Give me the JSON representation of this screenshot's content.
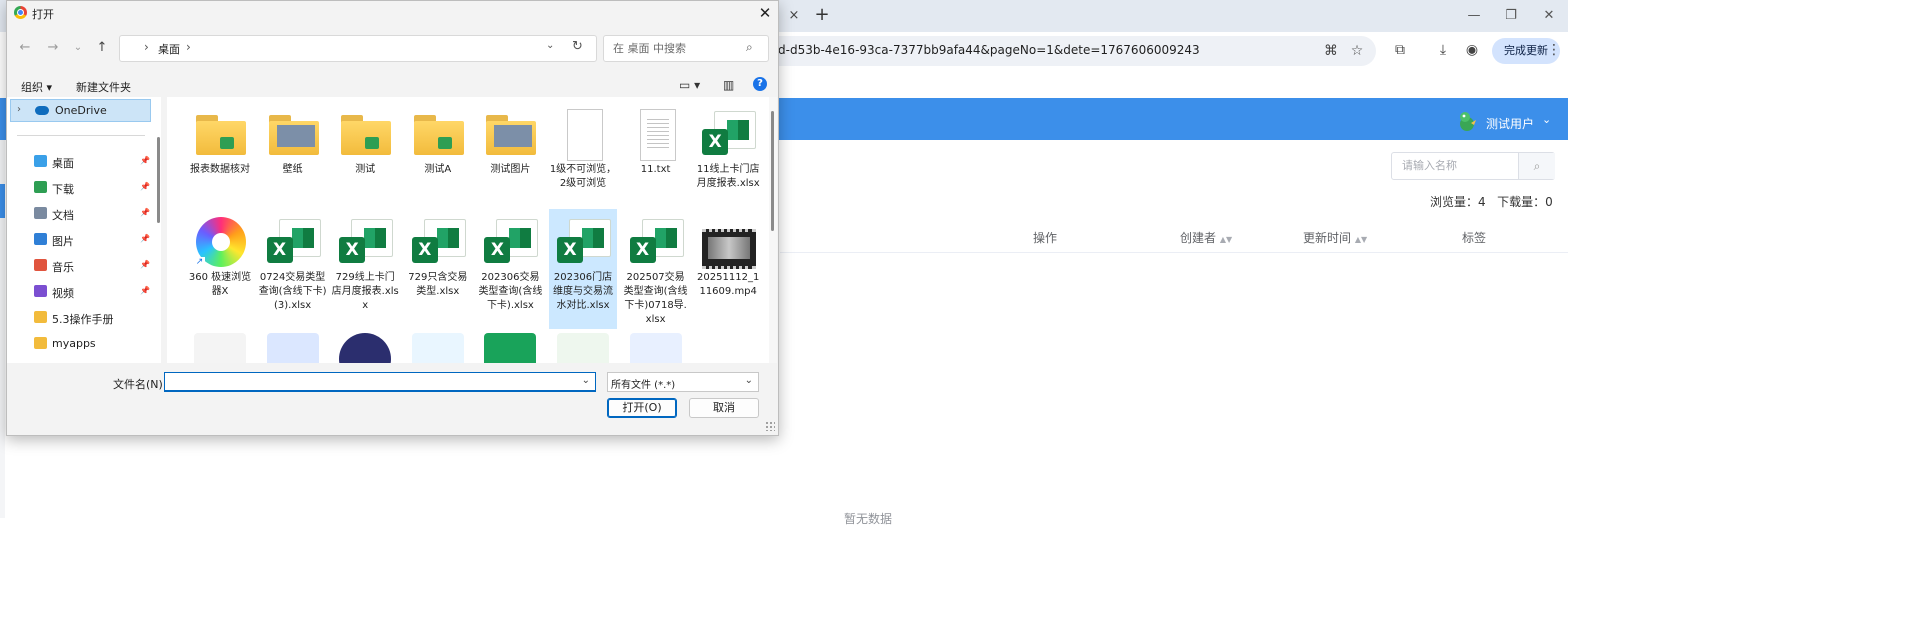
{
  "browser": {
    "url": "d-d53b-4e16-93ca-7377bb9afa44&pageNo=1&dete=1767606009243",
    "update_label": "完成更新",
    "new_tab_glyph": "+",
    "close_tab_glyph": "×"
  },
  "app": {
    "user_name": "测试用户",
    "search_placeholder": "请输入名称",
    "views_label": "浏览量：",
    "views_value": "4",
    "downloads_label": "下载量：",
    "downloads_value": "0",
    "columns": [
      "操作",
      "创建者",
      "更新时间",
      "标签"
    ],
    "empty_text": "暂无数据",
    "header_color": "#3c8fea"
  },
  "dialog": {
    "title": "打开",
    "breadcrumb": "桌面",
    "search_placeholder": "在 桌面 中搜索",
    "organize_label": "组织 ▾",
    "new_folder_label": "新建文件夹",
    "nav": {
      "onedrive": "OneDrive",
      "items": [
        {
          "label": "桌面",
          "icon": "desktop-icon",
          "color": "#3aa0e8",
          "pinned": true
        },
        {
          "label": "下载",
          "icon": "download-icon",
          "color": "#2e9e53",
          "pinned": true
        },
        {
          "label": "文档",
          "icon": "document-icon",
          "color": "#7a8aa0",
          "pinned": true
        },
        {
          "label": "图片",
          "icon": "picture-icon",
          "color": "#2f7fd6",
          "pinned": true
        },
        {
          "label": "音乐",
          "icon": "music-icon",
          "color": "#e0543e",
          "pinned": true
        },
        {
          "label": "视频",
          "icon": "video-icon",
          "color": "#7b4fd1",
          "pinned": true
        },
        {
          "label": "5.3操作手册",
          "icon": "folder-icon",
          "color": "#f2bb3c",
          "pinned": false
        },
        {
          "label": "myapps",
          "icon": "folder-icon",
          "color": "#f2bb3c",
          "pinned": false
        }
      ]
    },
    "files": [
      {
        "name": "报表数据核对",
        "type": "folder",
        "variant": "xls"
      },
      {
        "name": "壁纸",
        "type": "folder",
        "variant": "image"
      },
      {
        "name": "测试",
        "type": "folder",
        "variant": "xls"
      },
      {
        "name": "测试A",
        "type": "folder",
        "variant": "xls"
      },
      {
        "name": "测试图片",
        "type": "folder",
        "variant": "image"
      },
      {
        "name": "1级不可浏览，2级可浏览",
        "type": "blank"
      },
      {
        "name": "11.txt",
        "type": "txt"
      },
      {
        "name": "11线上卡门店月度报表.xlsx",
        "type": "xlsx"
      },
      {
        "name": "360 极速浏览器X",
        "type": "app"
      },
      {
        "name": "0724交易类型查询(含线下卡)(3).xlsx",
        "type": "xlsx"
      },
      {
        "name": "729线上卡门店月度报表.xlsx",
        "type": "xlsx"
      },
      {
        "name": "729只含交易类型.xlsx",
        "type": "xlsx"
      },
      {
        "name": "202306交易类型查询(含线下卡).xlsx",
        "type": "xlsx"
      },
      {
        "name": "202306门店维度与交易流水对比.xlsx",
        "type": "xlsx",
        "selected": true
      },
      {
        "name": "202507交易类型查询(含线下卡)0718导.xlsx",
        "type": "xlsx"
      },
      {
        "name": "20251112_111609.mp4",
        "type": "video"
      }
    ],
    "filename_label": "文件名(N):",
    "filetype_label": "所有文件 (*.*)",
    "open_label": "打开(O)",
    "cancel_label": "取消"
  }
}
